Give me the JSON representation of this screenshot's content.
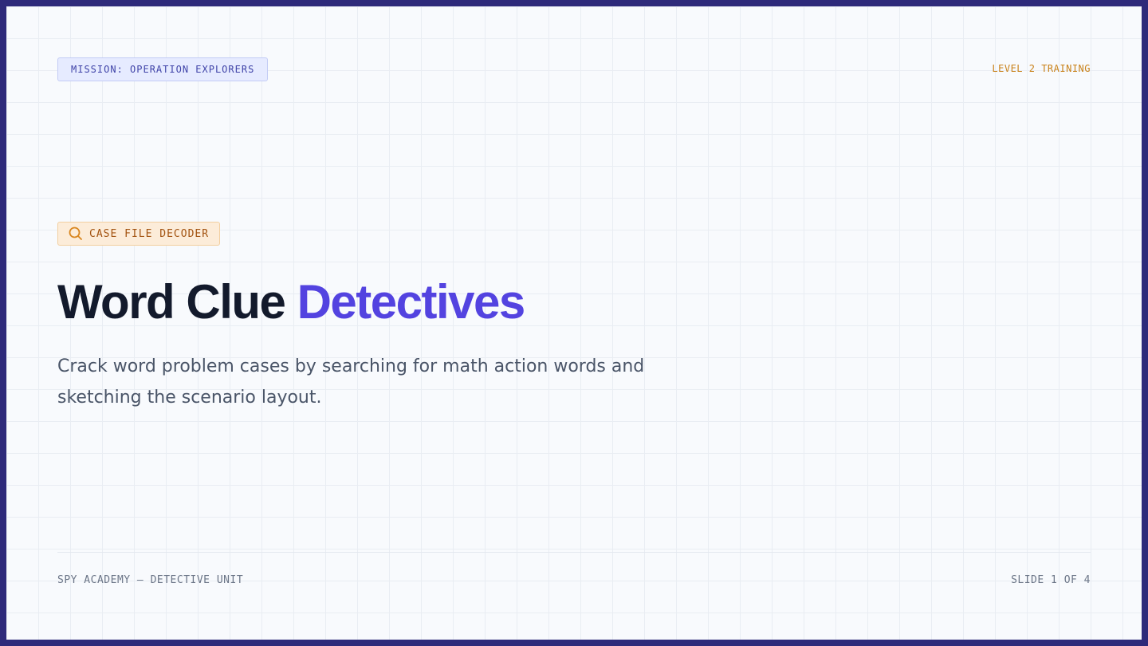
{
  "header": {
    "mission_label": "MISSION: OPERATION EXPLORERS",
    "level_label": "LEVEL 2 TRAINING"
  },
  "hero": {
    "badge_icon": "magnifier-icon",
    "badge_label": "CASE FILE DECODER",
    "title_primary": "Word Clue",
    "title_accent": "Detectives",
    "subtitle": "Crack word problem cases by searching for math action words and sketching the scenario layout."
  },
  "footer": {
    "unit_label": "SPY ACADEMY — DETECTIVE UNIT",
    "slide_counter": "SLIDE 1 OF 4"
  },
  "colors": {
    "frame_border": "#2e2a7a",
    "accent": "#5343e0",
    "title_dark": "#131a2c",
    "level_orange": "#c9821a",
    "badge_orange": "#a2520f",
    "mission_blue": "#3f43a8"
  }
}
